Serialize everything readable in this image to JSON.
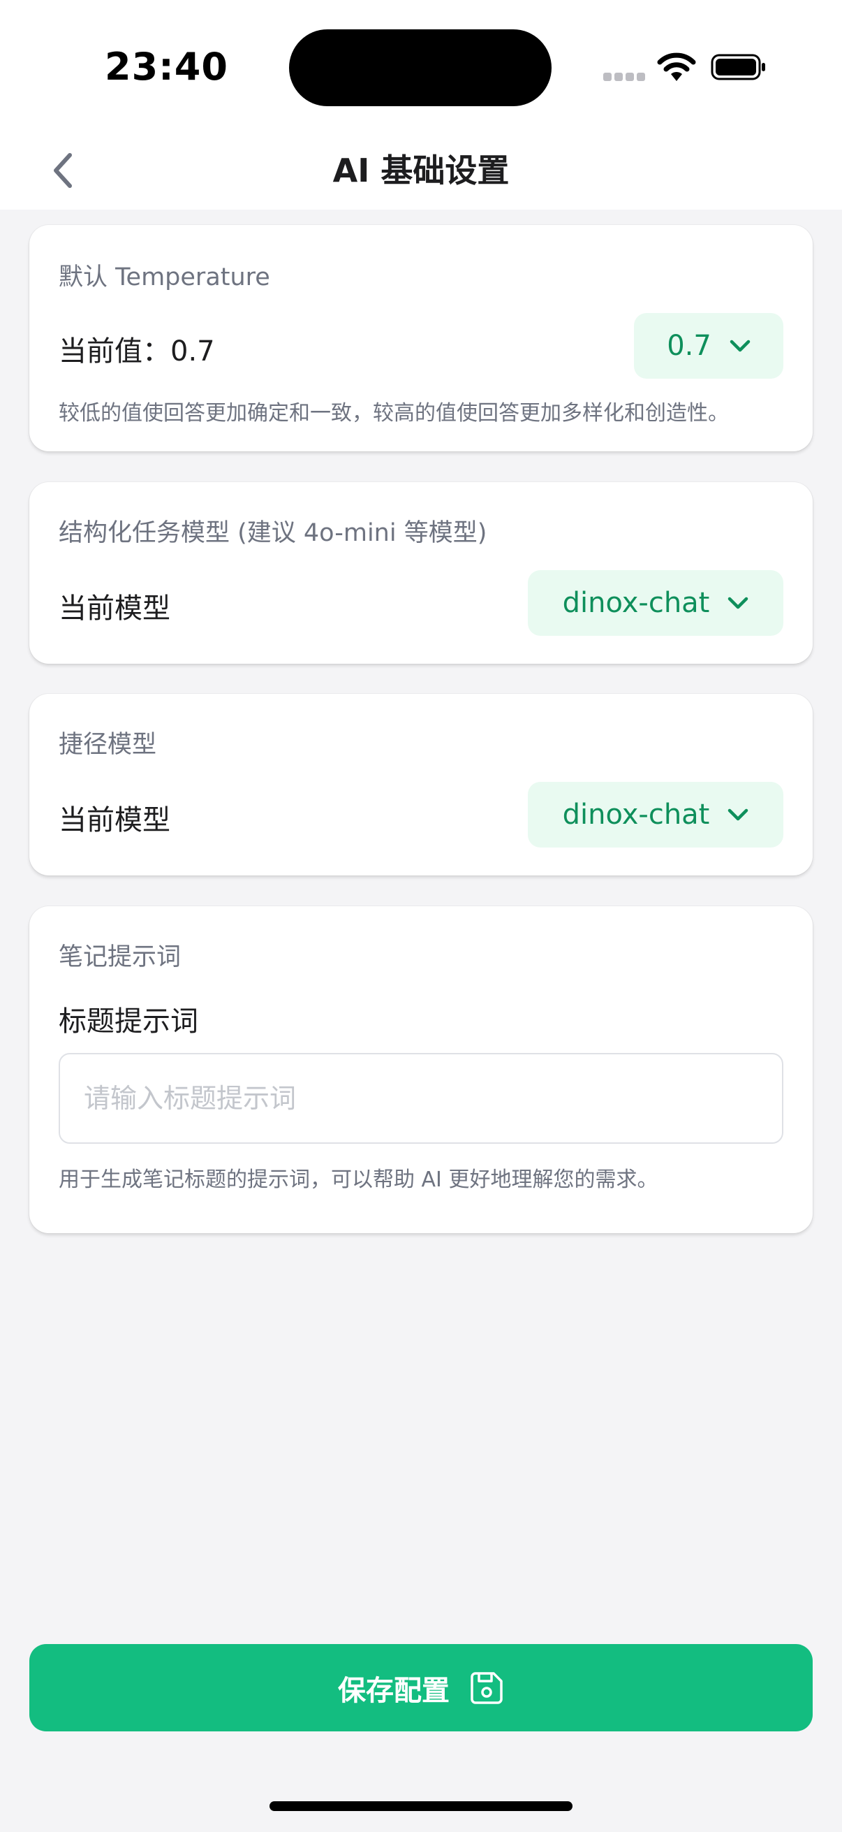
{
  "status_bar": {
    "time": "23:40",
    "icons": [
      "signal-dots-icon",
      "wifi-icon",
      "battery-icon"
    ]
  },
  "nav": {
    "title": "AI 基础设置",
    "back_icon": "chevron-left-icon"
  },
  "temperature_card": {
    "title": "默认 Temperature",
    "current_label": "当前值：0.7",
    "selected_value": "0.7",
    "hint": "较低的值使回答更加确定和一致，较高的值使回答更加多样化和创造性。"
  },
  "structured_model_card": {
    "title": "结构化任务模型 (建议 4o-mini 等模型)",
    "current_label": "当前模型",
    "selected_value": "dinox-chat"
  },
  "shortcut_model_card": {
    "title": "捷径模型",
    "current_label": "当前模型",
    "selected_value": "dinox-chat"
  },
  "note_prompt_card": {
    "title": "笔记提示词",
    "field_label": "标题提示词",
    "input_value": "",
    "input_placeholder": "请输入标题提示词",
    "hint": "用于生成笔记标题的提示词，可以帮助 AI 更好地理解您的需求。"
  },
  "save_button": {
    "label": "保存配置",
    "icon": "save-icon"
  },
  "colors": {
    "accent": "#13bd80",
    "accent_text": "#0e8f5b",
    "pill_bg": "#e9faf1",
    "page_bg": "#f4f4f6",
    "muted_text": "#6e7380"
  }
}
